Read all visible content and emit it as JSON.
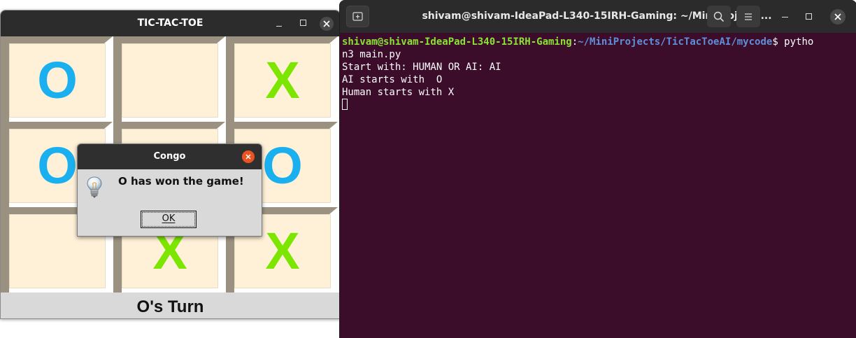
{
  "ttt_window": {
    "title": "TIC-TAC-TOE",
    "board": [
      "O",
      "",
      "X",
      "O",
      "",
      "O",
      "",
      "X",
      "X"
    ],
    "status": "O's Turn"
  },
  "dialog": {
    "title": "Congo",
    "message": "O has won the game!",
    "ok_label": "OK",
    "icon": "lightbulb-icon"
  },
  "terminal": {
    "title": "shivam@shivam-IdeaPad-L340-15IRH-Gaming: ~/MiniProjects...",
    "prompt_user": "shivam@shivam-IdeaPad-L340-15IRH-Gaming",
    "prompt_sep": ":",
    "prompt_path": "~/MiniProjects/TicTacToeAI/mycode",
    "prompt_dollar": "$ pytho",
    "command_wrap": "n3 main.py",
    "output": [
      "Start with: HUMAN OR AI: AI",
      "AI starts with  O",
      "Human starts with X"
    ]
  },
  "colors": {
    "o_mark": "#1ab0f0",
    "x_mark": "#7ce600",
    "cell_face": "#fff0d8",
    "terminal_bg": "#3c0c2b",
    "prompt_user": "#8ae234",
    "prompt_path": "#5f8fd6",
    "dialog_close": "#e95420"
  }
}
